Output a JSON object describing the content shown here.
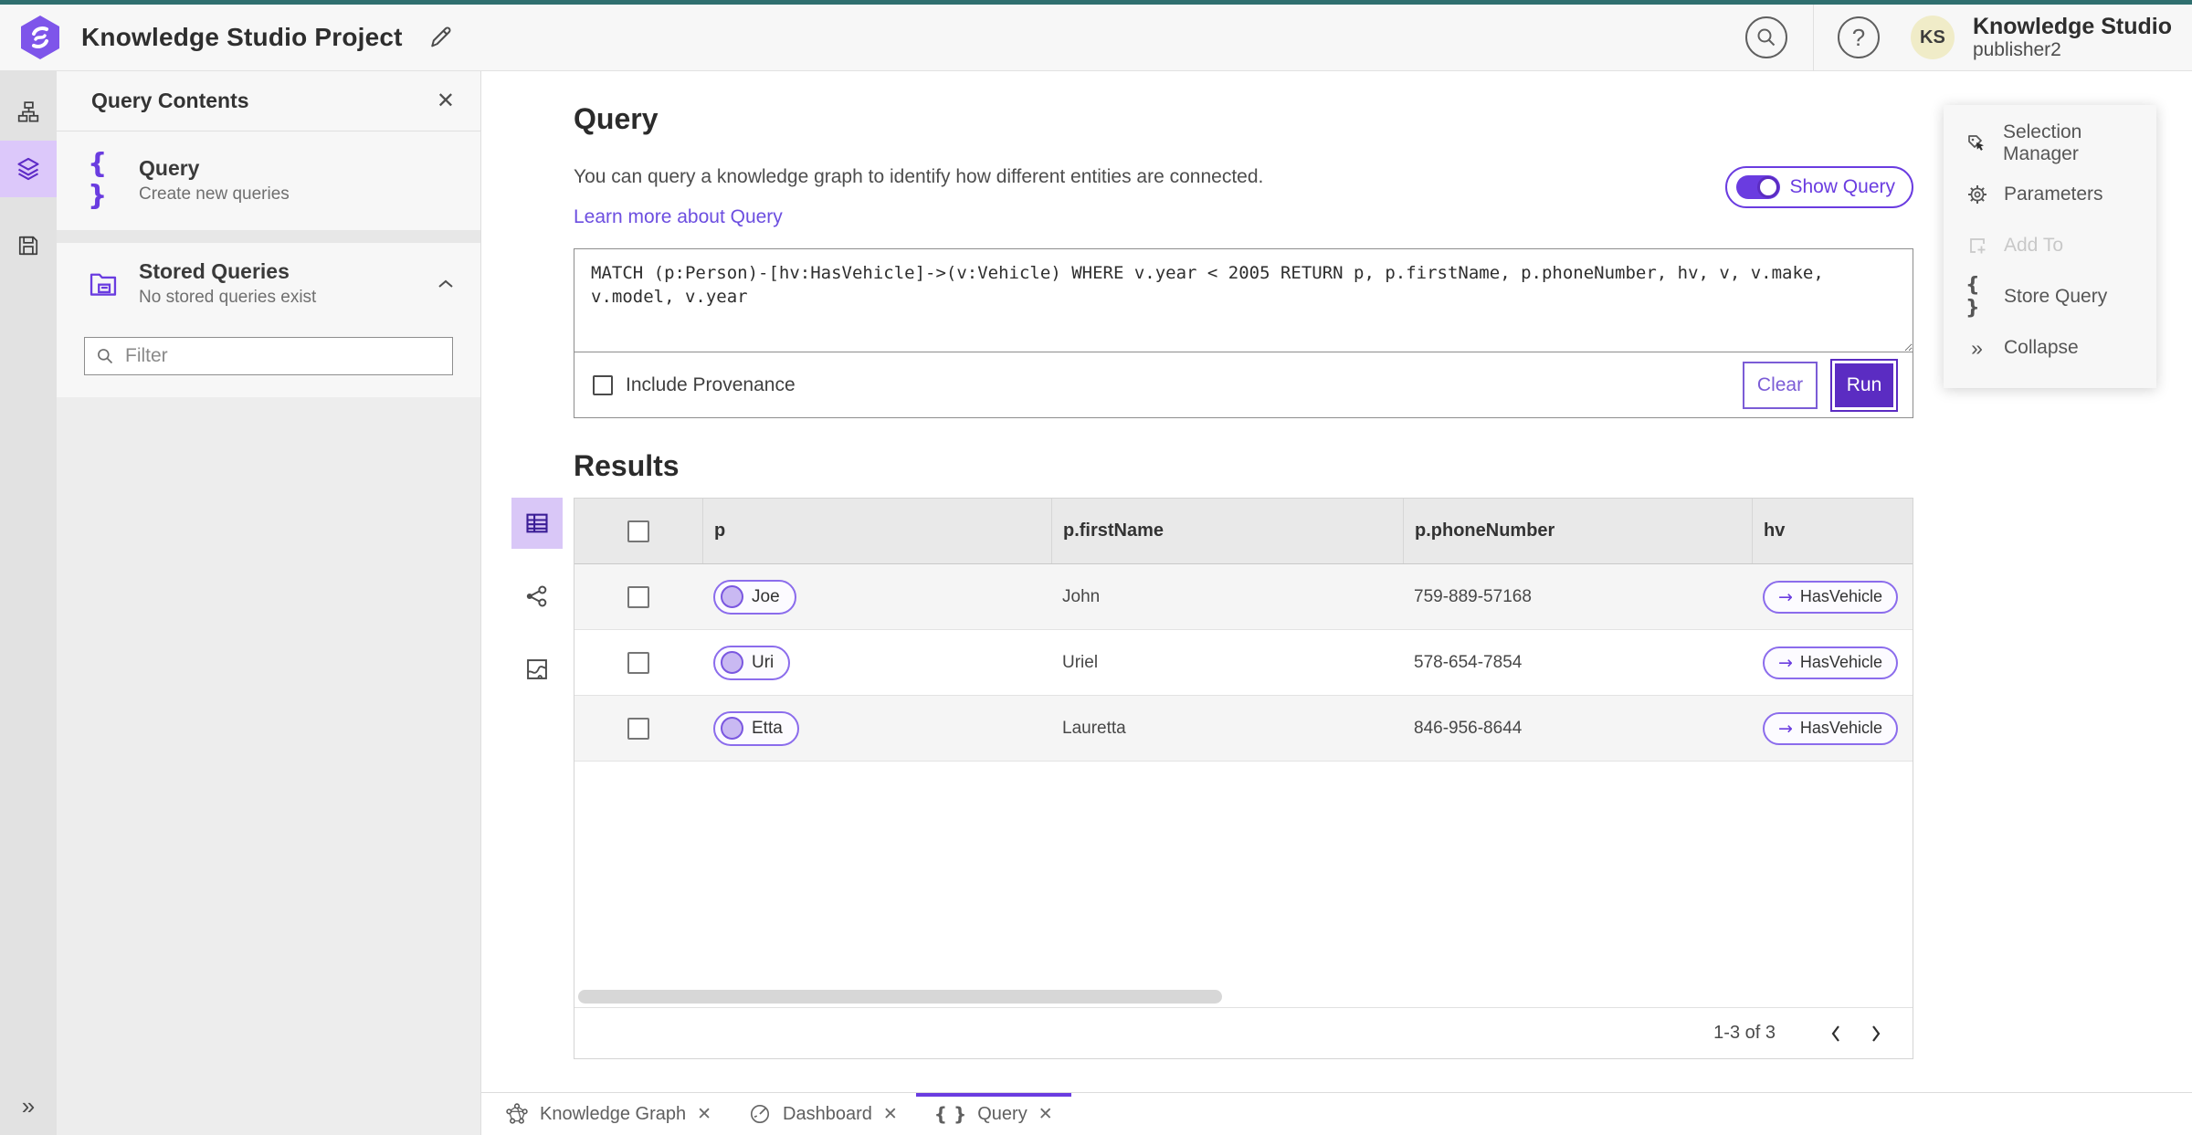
{
  "app": {
    "title": "Knowledge Studio Project",
    "product": "Knowledge Studio",
    "user": "publisher2",
    "avatar_initials": "KS",
    "help_glyph": "?"
  },
  "sidebar": {
    "panel_title": "Query Contents",
    "query_section": {
      "title": "Query",
      "subtitle": "Create new queries"
    },
    "stored_section": {
      "title": "Stored Queries",
      "subtitle": "No stored queries exist"
    },
    "filter_placeholder": "Filter"
  },
  "query": {
    "heading": "Query",
    "description": "You can query a knowledge graph to identify how different entities are connected.",
    "learn_more": "Learn more about Query",
    "show_query_label": "Show Query",
    "text": "MATCH (p:Person)-[hv:HasVehicle]->(v:Vehicle) WHERE v.year < 2005 RETURN p, p.firstName, p.phoneNumber, hv, v, v.make, v.model, v.year",
    "include_provenance_label": "Include Provenance",
    "clear_label": "Clear",
    "run_label": "Run"
  },
  "results": {
    "heading": "Results",
    "columns": [
      "p",
      "p.firstName",
      "p.phoneNumber",
      "hv"
    ],
    "rows": [
      {
        "p": "Joe",
        "firstName": "John",
        "phoneNumber": "759-889-57168",
        "hv": "HasVehicle"
      },
      {
        "p": "Uri",
        "firstName": "Uriel",
        "phoneNumber": "578-654-7854",
        "hv": "HasVehicle"
      },
      {
        "p": "Etta",
        "firstName": "Lauretta",
        "phoneNumber": "846-956-8644",
        "hv": "HasVehicle"
      }
    ],
    "edge_arrow": "→",
    "pagination": "1-3 of 3"
  },
  "tools": {
    "items": [
      "Selection Manager",
      "Parameters",
      "Add To",
      "Store Query",
      "Collapse"
    ]
  },
  "tabs": [
    {
      "label": "Knowledge Graph"
    },
    {
      "label": "Dashboard"
    },
    {
      "label": "Query"
    }
  ],
  "colors": {
    "accent_purple": "#5b2cc2",
    "accent_purple_light": "#dcc8fa",
    "top_teal": "#2f6f6f",
    "avatar_bg": "#f0ecc8"
  }
}
